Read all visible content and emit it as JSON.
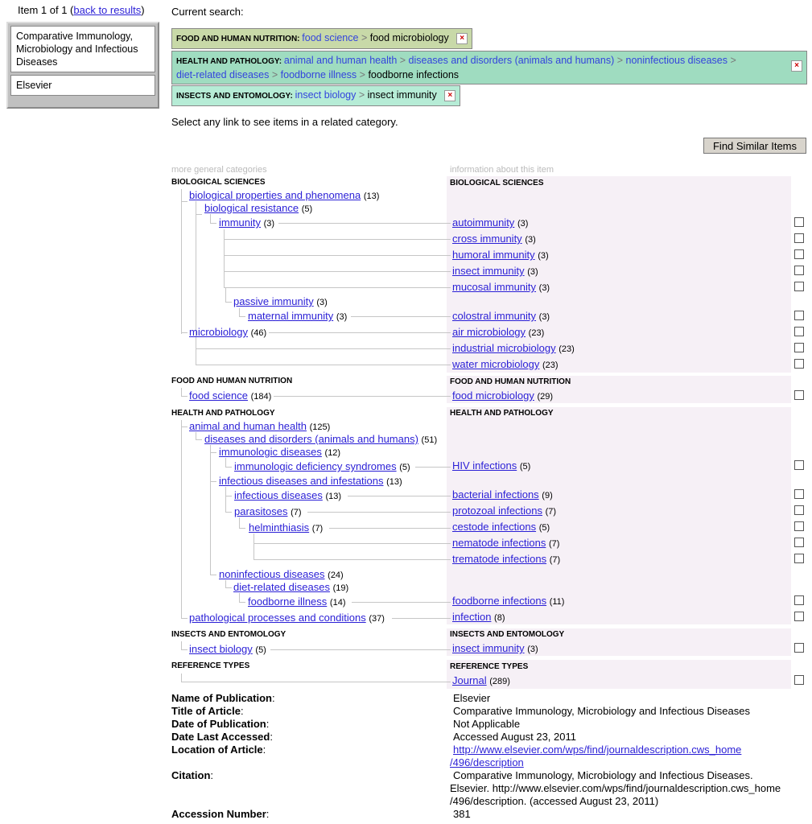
{
  "nav": {
    "prefix": "Item 1 of 1 (",
    "back_label": "back to results",
    "suffix": ")"
  },
  "left_box": {
    "title": "Comparative Immunology, Microbiology and Infectious Diseases",
    "publisher": "Elsevier"
  },
  "current_search_label": "Current search:",
  "search_tags": [
    {
      "category": "FOOD AND HUMAN NUTRITION",
      "path": [
        "food science"
      ],
      "current": "food microbiology",
      "color": "#c8d9a8"
    },
    {
      "category": "HEALTH AND PATHOLOGY",
      "path": [
        "animal and human health",
        "diseases and disorders (animals and humans)",
        "noninfectious diseases",
        "diet-related diseases",
        "foodborne illness"
      ],
      "current": "foodborne infections",
      "color": "#9fdcc0"
    },
    {
      "category": "INSECTS AND ENTOMOLOGY",
      "path": [
        "insect biology"
      ],
      "current": "insect immunity",
      "color": "#b6ecd6"
    }
  ],
  "instruction": "Select any link to see items in a related category.",
  "find_similar_label": "Find Similar Items",
  "col_headers": {
    "left": "more general categories",
    "right": "information about this item"
  },
  "sections": {
    "bio": "BIOLOGICAL SCIENCES",
    "food": "FOOD AND HUMAN NUTRITION",
    "health": "HEALTH AND PATHOLOGY",
    "insects": "INSECTS AND ENTOMOLOGY",
    "ref": "REFERENCE TYPES"
  },
  "general": {
    "bio_props": {
      "label": "biological properties and phenomena",
      "count": "(13)"
    },
    "bio_resist": {
      "label": "biological resistance",
      "count": "(5)"
    },
    "immunity": {
      "label": "immunity",
      "count": "(3)"
    },
    "passive": {
      "label": "passive immunity",
      "count": "(3)"
    },
    "maternal": {
      "label": "maternal immunity",
      "count": "(3)"
    },
    "microbiology": {
      "label": "microbiology",
      "count": "(46)"
    },
    "food_science": {
      "label": "food science",
      "count": "(184)"
    },
    "animal_health": {
      "label": "animal and human health",
      "count": "(125)"
    },
    "diseases": {
      "label": "diseases and disorders (animals and humans)",
      "count": "(51)"
    },
    "immunologic": {
      "label": "immunologic diseases",
      "count": "(12)"
    },
    "immuno_def": {
      "label": "immunologic deficiency syndromes",
      "count": "(5)"
    },
    "infect_infest": {
      "label": "infectious diseases and infestations",
      "count": "(13)"
    },
    "infectious": {
      "label": "infectious diseases",
      "count": "(13)"
    },
    "parasitoses": {
      "label": "parasitoses",
      "count": "(7)"
    },
    "helminthiasis": {
      "label": "helminthiasis",
      "count": "(7)"
    },
    "noninfectious": {
      "label": "noninfectious diseases",
      "count": "(24)"
    },
    "diet_related": {
      "label": "diet-related diseases",
      "count": "(19)"
    },
    "foodborne_ill": {
      "label": "foodborne illness",
      "count": "(14)"
    },
    "pathological": {
      "label": "pathological processes and conditions",
      "count": "(37)"
    },
    "insect_bio": {
      "label": "insect biology",
      "count": "(5)"
    }
  },
  "specific": {
    "autoimmunity": {
      "label": "autoimmunity",
      "count": "(3)"
    },
    "cross": {
      "label": "cross immunity",
      "count": "(3)"
    },
    "humoral": {
      "label": "humoral immunity",
      "count": "(3)"
    },
    "insect_imm": {
      "label": "insect immunity",
      "count": "(3)"
    },
    "mucosal": {
      "label": "mucosal immunity",
      "count": "(3)"
    },
    "colostral": {
      "label": "colostral immunity",
      "count": "(3)"
    },
    "air": {
      "label": "air microbiology",
      "count": "(23)"
    },
    "industrial": {
      "label": "industrial microbiology",
      "count": "(23)"
    },
    "water": {
      "label": "water microbiology",
      "count": "(23)"
    },
    "food_micro": {
      "label": "food microbiology",
      "count": "(29)"
    },
    "hiv": {
      "label": "HIV infections",
      "count": "(5)"
    },
    "bacterial": {
      "label": "bacterial infections",
      "count": "(9)"
    },
    "protozoal": {
      "label": "protozoal infections",
      "count": "(7)"
    },
    "cestode": {
      "label": "cestode infections",
      "count": "(5)"
    },
    "nematode": {
      "label": "nematode infections",
      "count": "(7)"
    },
    "trematode": {
      "label": "trematode infections",
      "count": "(7)"
    },
    "foodborne_inf": {
      "label": "foodborne infections",
      "count": "(11)"
    },
    "infection": {
      "label": "infection",
      "count": "(8)"
    },
    "insect_imm2": {
      "label": "insect immunity",
      "count": "(3)"
    },
    "journal": {
      "label": "Journal",
      "count": "(289)"
    }
  },
  "metadata": {
    "pub_name_label": "Name of Publication",
    "pub_name": "Elsevier",
    "title_label": "Title of Article",
    "title": "Comparative Immunology, Microbiology and Infectious Diseases",
    "date_pub_label": "Date of Publication",
    "date_pub": "Not Applicable",
    "accessed_label": "Date Last Accessed",
    "accessed": "Accessed August 23, 2011",
    "location_label": "Location of Article",
    "location_line1": "http://www.elsevier.com/wps/find/journaldescription.cws_home",
    "location_line2": "/496/description",
    "citation_label": "Citation",
    "citation_line1": "Comparative Immunology, Microbiology and Infectious Diseases.",
    "citation_line2": "Elsevier. http://www.elsevier.com/wps/find/journaldescription.cws_home",
    "citation_line3": "/496/description. (accessed August 23, 2011)",
    "accession_label": "Accession Number",
    "accession": "381"
  }
}
